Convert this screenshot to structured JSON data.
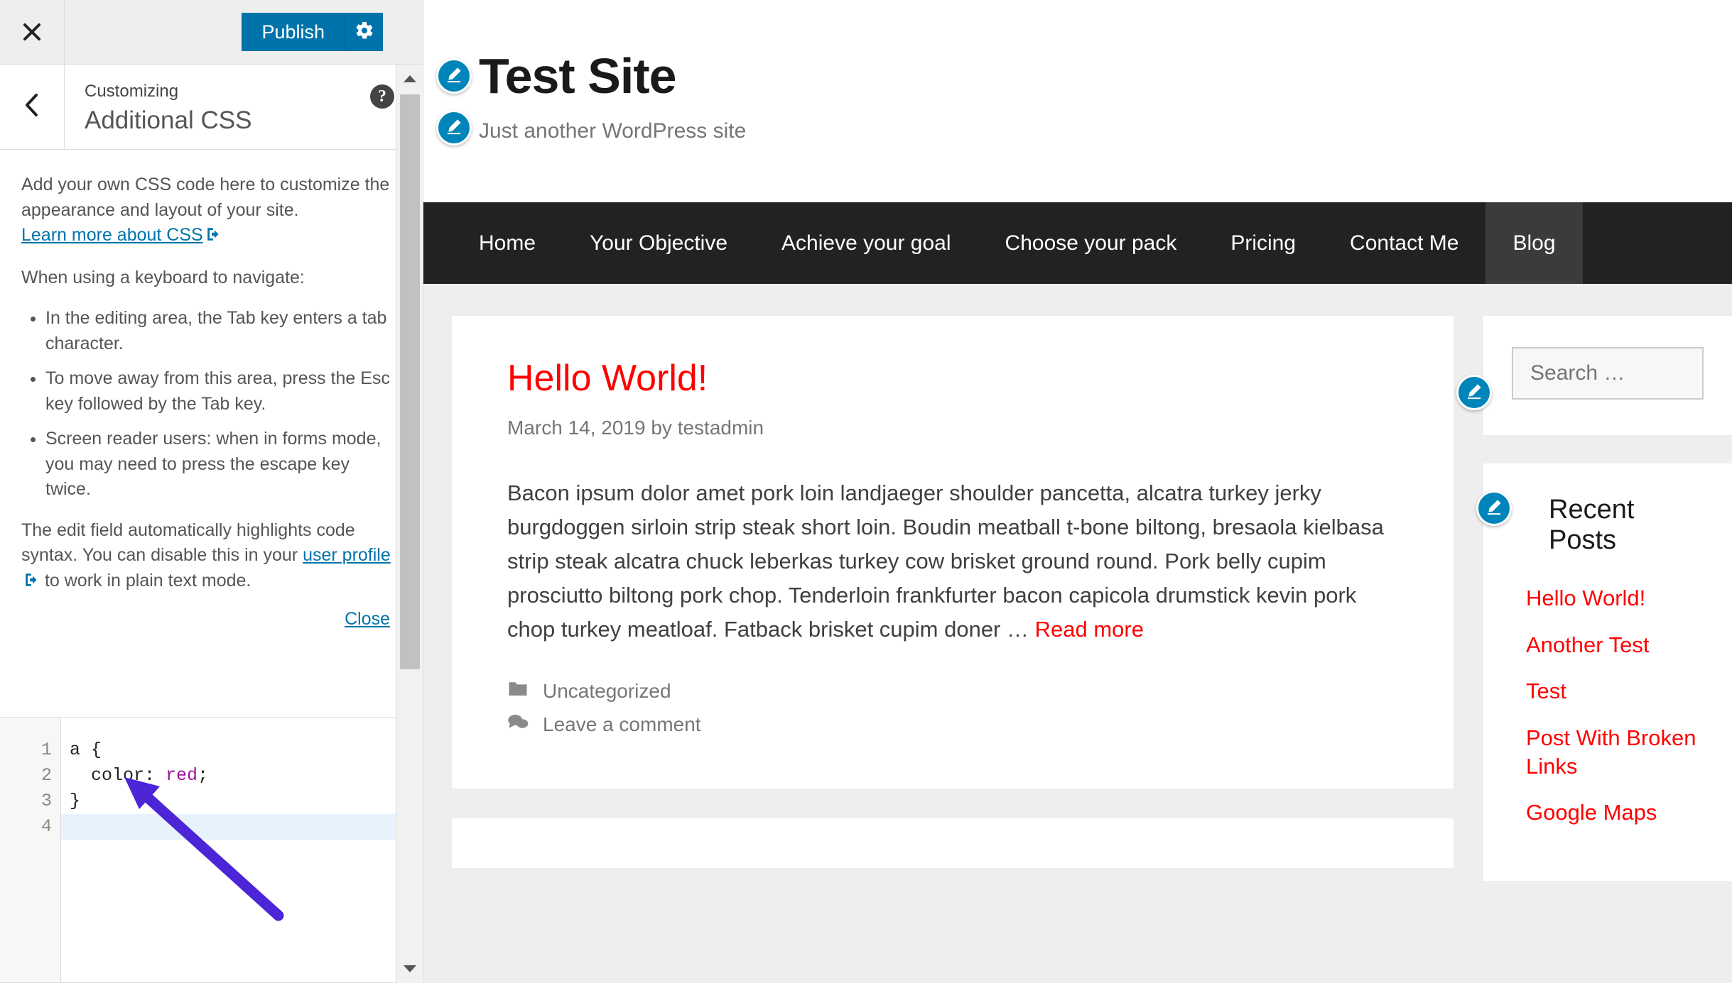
{
  "customizer": {
    "close_icon": "close-icon",
    "publish_label": "Publish",
    "gear_icon": "gear-icon",
    "back_icon": "chevron-left-icon",
    "help_icon": "help-icon",
    "breadcrumb": "Customizing",
    "panel_title": "Additional CSS",
    "intro": "Add your own CSS code here to customize the appearance and layout of your site.",
    "learn_more_link": "Learn more about CSS",
    "keyboard_intro": "When using a keyboard to navigate:",
    "bullets": [
      "In the editing area, the Tab key enters a tab character.",
      "To move away from this area, press the Esc key followed by the Tab key.",
      "Screen reader users: when in forms mode, you may need to press the escape key twice."
    ],
    "syntax_note_a": "The edit field automatically highlights code syntax. You can disable this in your ",
    "syntax_note_link": "user profile",
    "syntax_note_b": " to work in plain text mode.",
    "close_link": "Close",
    "editor": {
      "line_numbers": [
        "1",
        "2",
        "3",
        "4"
      ],
      "lines": [
        "a {",
        "  color: red;",
        "}",
        ""
      ],
      "code_property": "color:",
      "code_value": "red",
      "active_line": "4"
    }
  },
  "preview": {
    "site_title": "Test Site",
    "site_description": "Just another WordPress site",
    "edit_icon": "pencil-edit-icon",
    "nav": [
      {
        "label": "Home",
        "active": false
      },
      {
        "label": "Your Objective",
        "active": false
      },
      {
        "label": "Achieve your goal",
        "active": false
      },
      {
        "label": "Choose your pack",
        "active": false
      },
      {
        "label": "Pricing",
        "active": false
      },
      {
        "label": "Contact Me",
        "active": false
      },
      {
        "label": "Blog",
        "active": true
      }
    ],
    "post": {
      "title": "Hello World!",
      "meta": "March 14, 2019 by testadmin",
      "body": "Bacon ipsum dolor amet pork loin landjaeger shoulder pancetta, alcatra turkey jerky burgdoggen sirloin strip steak short loin. Boudin meatball t-bone biltong, bresaola kielbasa strip steak alcatra chuck leberkas turkey cow brisket ground round. Pork belly cupim prosciutto biltong pork chop. Tenderloin frankfurter bacon capicola drumstick kevin pork chop turkey meatloaf. Fatback brisket cupim doner ",
      "ellipsis": "… ",
      "read_more": "Read more",
      "category_icon": "folder-icon",
      "category": "Uncategorized",
      "comment_icon": "comment-icon",
      "comment_label": "Leave a comment"
    },
    "sidebar": {
      "search_placeholder": "Search …",
      "recent_posts_title": "Recent Posts",
      "recent_posts": [
        "Hello World!",
        "Another Test",
        "Test",
        "Post With Broken Links",
        "Google Maps"
      ]
    }
  },
  "colors": {
    "accent_blue": "#0073aa",
    "link_red": "#ff0000",
    "nav_dark": "#222222",
    "arrow_purple": "#4b25d6"
  }
}
